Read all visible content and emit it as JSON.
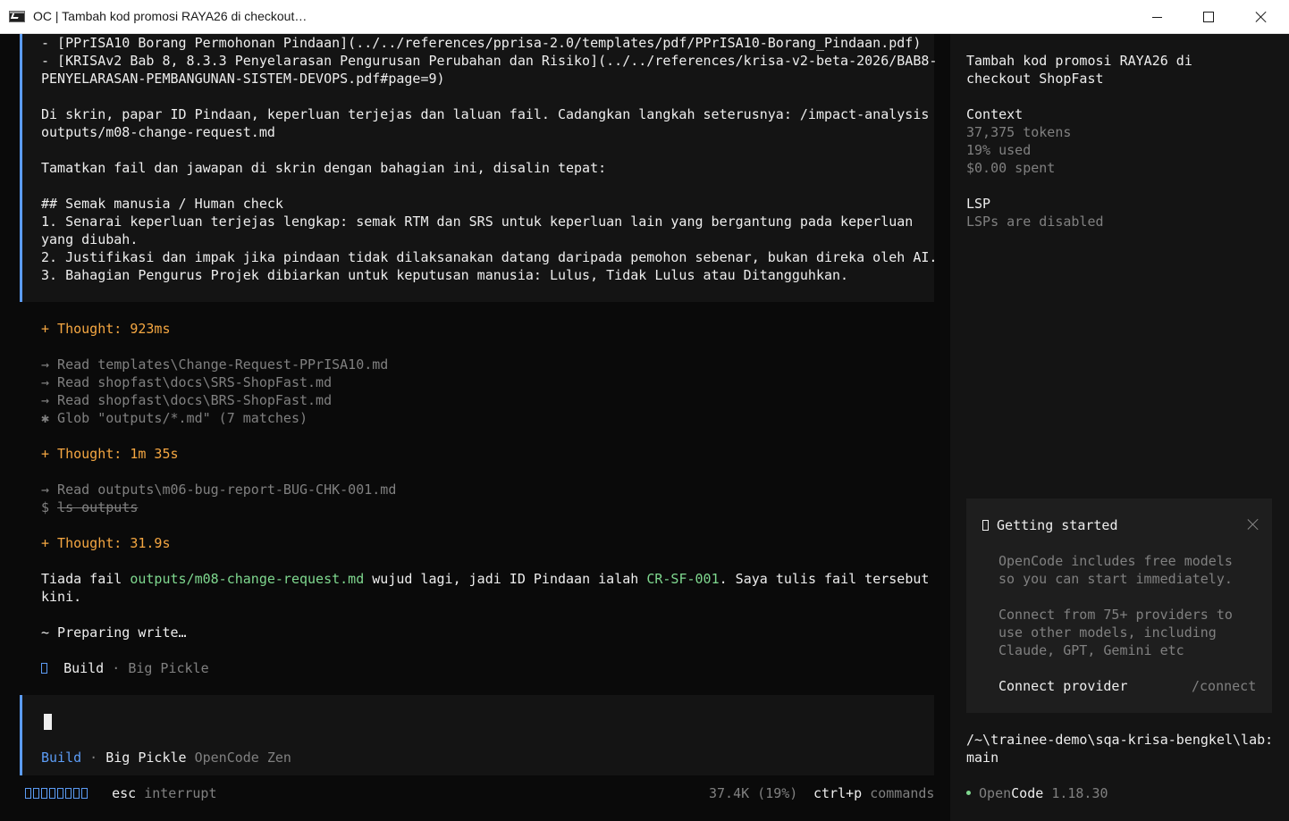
{
  "window": {
    "title": "OC | Tambah kod promosi RAYA26 di checkout…"
  },
  "conversation": {
    "message_lines": [
      "- [PPrISA10 Borang Permohonan Pindaan](../../references/pprisa-2.0/templates/pdf/PPrISA10-Borang_Pindaan.pdf)",
      "- [KRISAv2 Bab 8, 8.3.3 Penyelarasan Pengurusan Perubahan dan Risiko](../../references/krisa-v2-beta-2026/BAB8-",
      "PENYELARASAN-PEMBANGUNAN-SISTEM-DEVOPS.pdf#page=9)",
      "Di skrin, papar ID Pindaan, keperluan terjejas dan laluan fail. Cadangkan langkah seterusnya: /impact-analysis",
      "outputs/m08-change-request.md",
      "Tamatkan fail dan jawapan di skrin dengan bahagian ini, disalin tepat:",
      "## Semak manusia / Human check",
      "1. Senarai keperluan terjejas lengkap: semak RTM dan SRS untuk keperluan lain yang bergantung pada keperluan",
      "yang diubah.",
      "2. Justifikasi dan impak jika pindaan tidak dilaksanakan datang daripada pemohon sebenar, bukan direka oleh AI.",
      "3. Bahagian Pengurus Projek dibiarkan untuk keputusan manusia: Lulus, Tidak Lulus atau Ditangguhkan."
    ],
    "thought1": "+ Thought: 923ms",
    "tool_calls_1": [
      "→ Read templates\\Change-Request-PPrISA10.md",
      "→ Read shopfast\\docs\\SRS-ShopFast.md",
      "→ Read shopfast\\docs\\BRS-ShopFast.md",
      "✱ Glob \"outputs/*.md\" (7 matches)"
    ],
    "thought2": "+ Thought: 1m 35s",
    "tool_call_2": "→ Read outputs\\m06-bug-report-BUG-CHK-001.md",
    "shell_prefix": "$ ",
    "shell_cmd": "ls outputs",
    "thought3": "+ Thought: 31.9s",
    "reply": {
      "part1": "Tiada fail ",
      "file": "outputs/m08-change-request.md",
      "part2": " wujud lagi, jadi ID Pindaan ialah ",
      "id": "CR-SF-001",
      "part3": ". Saya tulis fail tersebut",
      "line2": "kini."
    },
    "preparing": "~ Preparing write…",
    "agent_line": {
      "agent": "Build",
      "separator": " · ",
      "model": "Big Pickle"
    }
  },
  "prompt": {
    "agent": "Build",
    "separator": " · ",
    "model": "Big Pickle",
    "provider": "OpenCode Zen"
  },
  "status_bar": {
    "esc_key": "esc",
    "esc_label": " interrupt",
    "usage": "37.4K (19%)",
    "cmd_key": "ctrl+p",
    "cmd_label": " commands"
  },
  "sidebar": {
    "session_title_lines": [
      "Tambah kod promosi RAYA26 di",
      "checkout ShopFast"
    ],
    "context": {
      "heading": "Context",
      "tokens": "37,375 tokens",
      "used": "19% used",
      "spent": "$0.00 spent"
    },
    "lsp": {
      "heading": "LSP",
      "status": "LSPs are disabled"
    },
    "getting_started": {
      "title": "Getting started",
      "body1": [
        "OpenCode includes free models",
        "so you can start immediately."
      ],
      "body2": [
        "Connect from 75+ providers to",
        "use other models, including",
        "Claude, GPT, Gemini etc"
      ],
      "connect_label": "Connect provider",
      "connect_cmd": "/connect"
    },
    "path_lines": [
      "/~\\trainee-demo\\sqa-krisa-bengkel\\lab:",
      "main"
    ],
    "version": {
      "open": "Open",
      "code": "Code",
      "number": "1.18.30"
    }
  },
  "colors": {
    "accent_blue": "#5c9cf5",
    "thought_orange": "#f5a742",
    "highlight_green": "#7fd88f",
    "panel_bg": "#141414",
    "main_bg": "#0a0a0a"
  },
  "icons": [
    "terminal-app-icon",
    "minimize-icon",
    "maximize-icon",
    "close-icon",
    "book-icon",
    "close-icon",
    "status-dot-icon"
  ]
}
